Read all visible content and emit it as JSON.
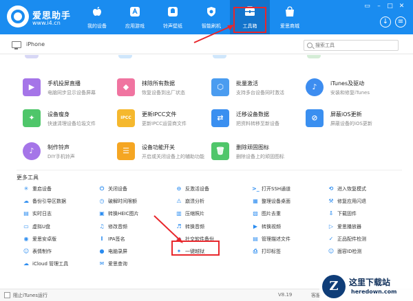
{
  "header": {
    "brand_name": "爱思助手",
    "brand_url": "www.i4.cn",
    "nav": [
      {
        "label": "我的设备",
        "icon": "apple-icon"
      },
      {
        "label": "应用游戏",
        "icon": "apps-icon"
      },
      {
        "label": "铃声壁纸",
        "icon": "bell-icon"
      },
      {
        "label": "智能刷机",
        "icon": "shield-icon"
      },
      {
        "label": "工具箱",
        "icon": "toolbox-icon",
        "active": true
      },
      {
        "label": "爱思商城",
        "icon": "shop-bag-icon"
      }
    ],
    "window": {
      "minimize": "–",
      "maximize": "□",
      "close": "✕",
      "tray": "▭"
    },
    "download": "↓",
    "menu": "≡"
  },
  "device_bar": {
    "device_name": "iPhone",
    "search_placeholder": "搜索工具"
  },
  "tools": [
    {
      "name": "手机投屏直播",
      "desc": "电脑同步显示设备屏幕",
      "icon": "screen-mirror-icon"
    },
    {
      "name": "抹除所有数据",
      "desc": "恢复设备到出厂状态",
      "icon": "eraser-icon"
    },
    {
      "name": "批量激活",
      "desc": "支持多台设备同时激活",
      "icon": "activate-icon"
    },
    {
      "name": "iTunes及驱动",
      "desc": "安装和修复iTunes",
      "icon": "music-note-icon"
    },
    {
      "name": "设备瘦身",
      "desc": "快速清理设备垃圾文件",
      "icon": "broom-icon"
    },
    {
      "name": "更新IPCC文件",
      "desc": "更新IPCC运营商文件",
      "icon": "ipcc-icon"
    },
    {
      "name": "迁移设备数据",
      "desc": "把资料转移至新设备",
      "icon": "transfer-icon"
    },
    {
      "name": "屏蔽iOS更新",
      "desc": "屏蔽设备的iOS更新",
      "icon": "block-update-icon"
    },
    {
      "name": "制作铃声",
      "desc": "DIY手机铃声",
      "icon": "ringtone-icon"
    },
    {
      "name": "设备功能开关",
      "desc": "开启或关闭设备上的辅助功能",
      "icon": "switches-icon"
    },
    {
      "name": "删除顽固图标",
      "desc": "删除设备上的顽固图标",
      "icon": "trash-icon"
    }
  ],
  "more_tools": {
    "title": "更多工具",
    "items": [
      {
        "label": "重启设备",
        "icon": "restart-icon",
        "color": "#2b8cf0"
      },
      {
        "label": "关闭设备",
        "icon": "power-icon",
        "color": "#2b8cf0"
      },
      {
        "label": "反激活设备",
        "icon": "deactivate-icon",
        "color": "#2b8cf0"
      },
      {
        "label": "打开SSH通道",
        "icon": "ssh-icon",
        "color": "#2b8cf0"
      },
      {
        "label": "进入恢复模式",
        "icon": "recovery-icon",
        "color": "#2b8cf0"
      },
      {
        "label": "备份引导区数据",
        "icon": "backup-boot-icon",
        "color": "#2b8cf0"
      },
      {
        "label": "破解时间限额",
        "icon": "time-limit-icon",
        "color": "#2b8cf0"
      },
      {
        "label": "崩溃分析",
        "icon": "crash-icon",
        "color": "#2b8cf0"
      },
      {
        "label": "整理设备桌面",
        "icon": "desktop-icon",
        "color": "#2b8cf0"
      },
      {
        "label": "修复应用闪退",
        "icon": "fix-crash-icon",
        "color": "#2b8cf0"
      },
      {
        "label": "实时日志",
        "icon": "log-icon",
        "color": "#2b8cf0"
      },
      {
        "label": "转换HEIC图片",
        "icon": "heic-icon",
        "color": "#2b8cf0"
      },
      {
        "label": "压缩照片",
        "icon": "compress-icon",
        "color": "#2b8cf0"
      },
      {
        "label": "图片去重",
        "icon": "dedupe-icon",
        "color": "#2b8cf0"
      },
      {
        "label": "下载固件",
        "icon": "firmware-icon",
        "color": "#2b8cf0"
      },
      {
        "label": "虚拟U盘",
        "icon": "udisk-icon",
        "color": "#2b8cf0"
      },
      {
        "label": "修改音频",
        "icon": "audio-icon",
        "color": "#2b8cf0"
      },
      {
        "label": "转换音频",
        "icon": "convert-audio-icon",
        "color": "#2b8cf0"
      },
      {
        "label": "转换视频",
        "icon": "convert-video-icon",
        "color": "#2b8cf0"
      },
      {
        "label": "爱思播放器",
        "icon": "player-icon",
        "color": "#2b8cf0"
      },
      {
        "label": "爱思安卓版",
        "icon": "android-icon",
        "color": "#2b8cf0"
      },
      {
        "label": "IPA签名",
        "icon": "ipa-icon",
        "color": "#2b8cf0"
      },
      {
        "label": "社交软件备份",
        "icon": "social-backup-icon",
        "color": "#2b8cf0"
      },
      {
        "label": "管理描述文件",
        "icon": "profile-icon",
        "color": "#2b8cf0"
      },
      {
        "label": "正品配件检测",
        "icon": "accessory-icon",
        "color": "#2b8cf0"
      },
      {
        "label": "表情制作",
        "icon": "emoji-icon",
        "color": "#2b8cf0"
      },
      {
        "label": "电脑录屏",
        "icon": "record-icon",
        "color": "#2b8cf0"
      },
      {
        "label": "一键越狱",
        "icon": "jailbreak-icon",
        "color": "#2b8cf0"
      },
      {
        "label": "打印标签",
        "icon": "printer-icon",
        "color": "#2b8cf0"
      },
      {
        "label": "面容ID检测",
        "icon": "faceid-icon",
        "color": "#2b8cf0"
      },
      {
        "label": "iCloud 管理工具",
        "icon": "icloud-icon",
        "color": "#2b8cf0"
      },
      {
        "label": "爱思查询",
        "icon": "query-icon",
        "color": "#2b8cf0"
      }
    ]
  },
  "status_bar": {
    "itunes_label": "阻止iTunes运行",
    "version": "V8.19",
    "help": "客服"
  },
  "watermark": {
    "badge_letter": "Z",
    "name": "这里下载站",
    "url": "heredown.com"
  },
  "colors": {
    "header": "#1a8cf0",
    "highlight": "#e8262b",
    "accent": "#2b8cf0"
  }
}
